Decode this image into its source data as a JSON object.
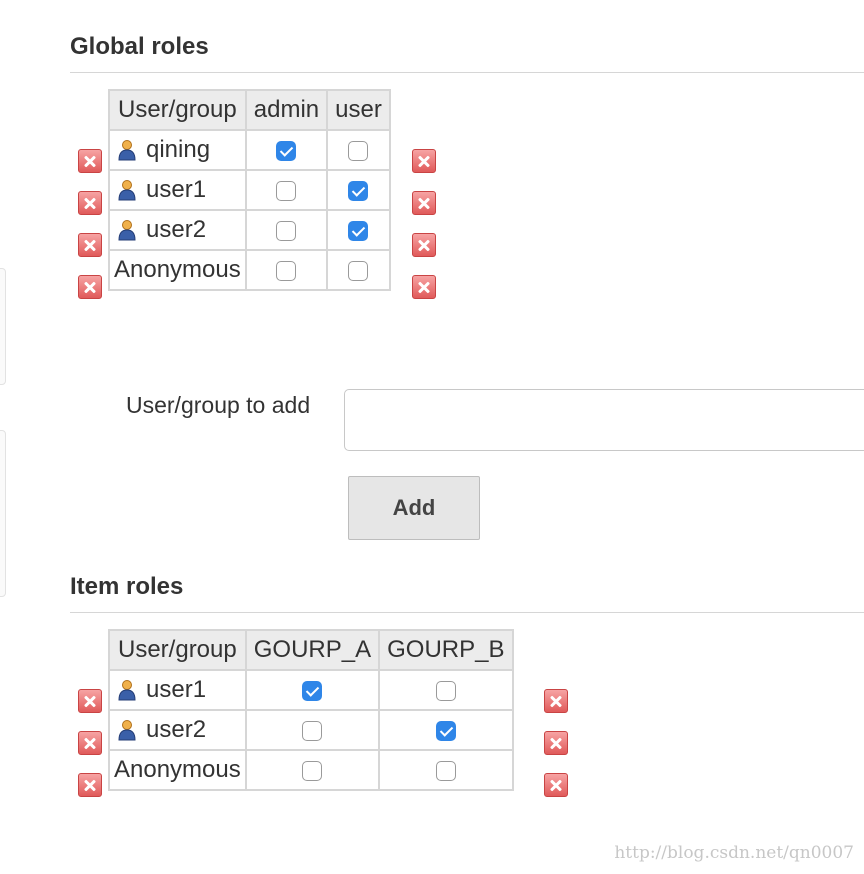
{
  "global_roles": {
    "title": "Global roles",
    "columns": [
      "User/group",
      "admin",
      "user"
    ],
    "rows": [
      {
        "name": "qining",
        "user_icon": "user-icon",
        "checks": [
          true,
          false
        ]
      },
      {
        "name": "user1",
        "user_icon": "user-icon",
        "checks": [
          false,
          true
        ]
      },
      {
        "name": "user2",
        "user_icon": "user-icon",
        "checks": [
          false,
          true
        ]
      },
      {
        "name": "Anonymous",
        "user_icon": "",
        "checks": [
          false,
          false
        ]
      }
    ]
  },
  "add_user": {
    "label": "User/group to add",
    "input_value": "",
    "button_label": "Add"
  },
  "item_roles": {
    "title": "Item roles",
    "columns": [
      "User/group",
      "GOURP_A",
      "GOURP_B"
    ],
    "rows": [
      {
        "name": "user1",
        "user_icon": "user-icon",
        "checks": [
          true,
          false
        ]
      },
      {
        "name": "user2",
        "user_icon": "user-icon",
        "checks": [
          false,
          true
        ]
      },
      {
        "name": "Anonymous",
        "user_icon": "",
        "checks": [
          false,
          false
        ]
      }
    ]
  },
  "watermark": "http://blog.csdn.net/qn0007",
  "colors": {
    "check_blue": "#2f86e8",
    "delete_red": "#e05a5a",
    "header_bg": "#ececec"
  }
}
